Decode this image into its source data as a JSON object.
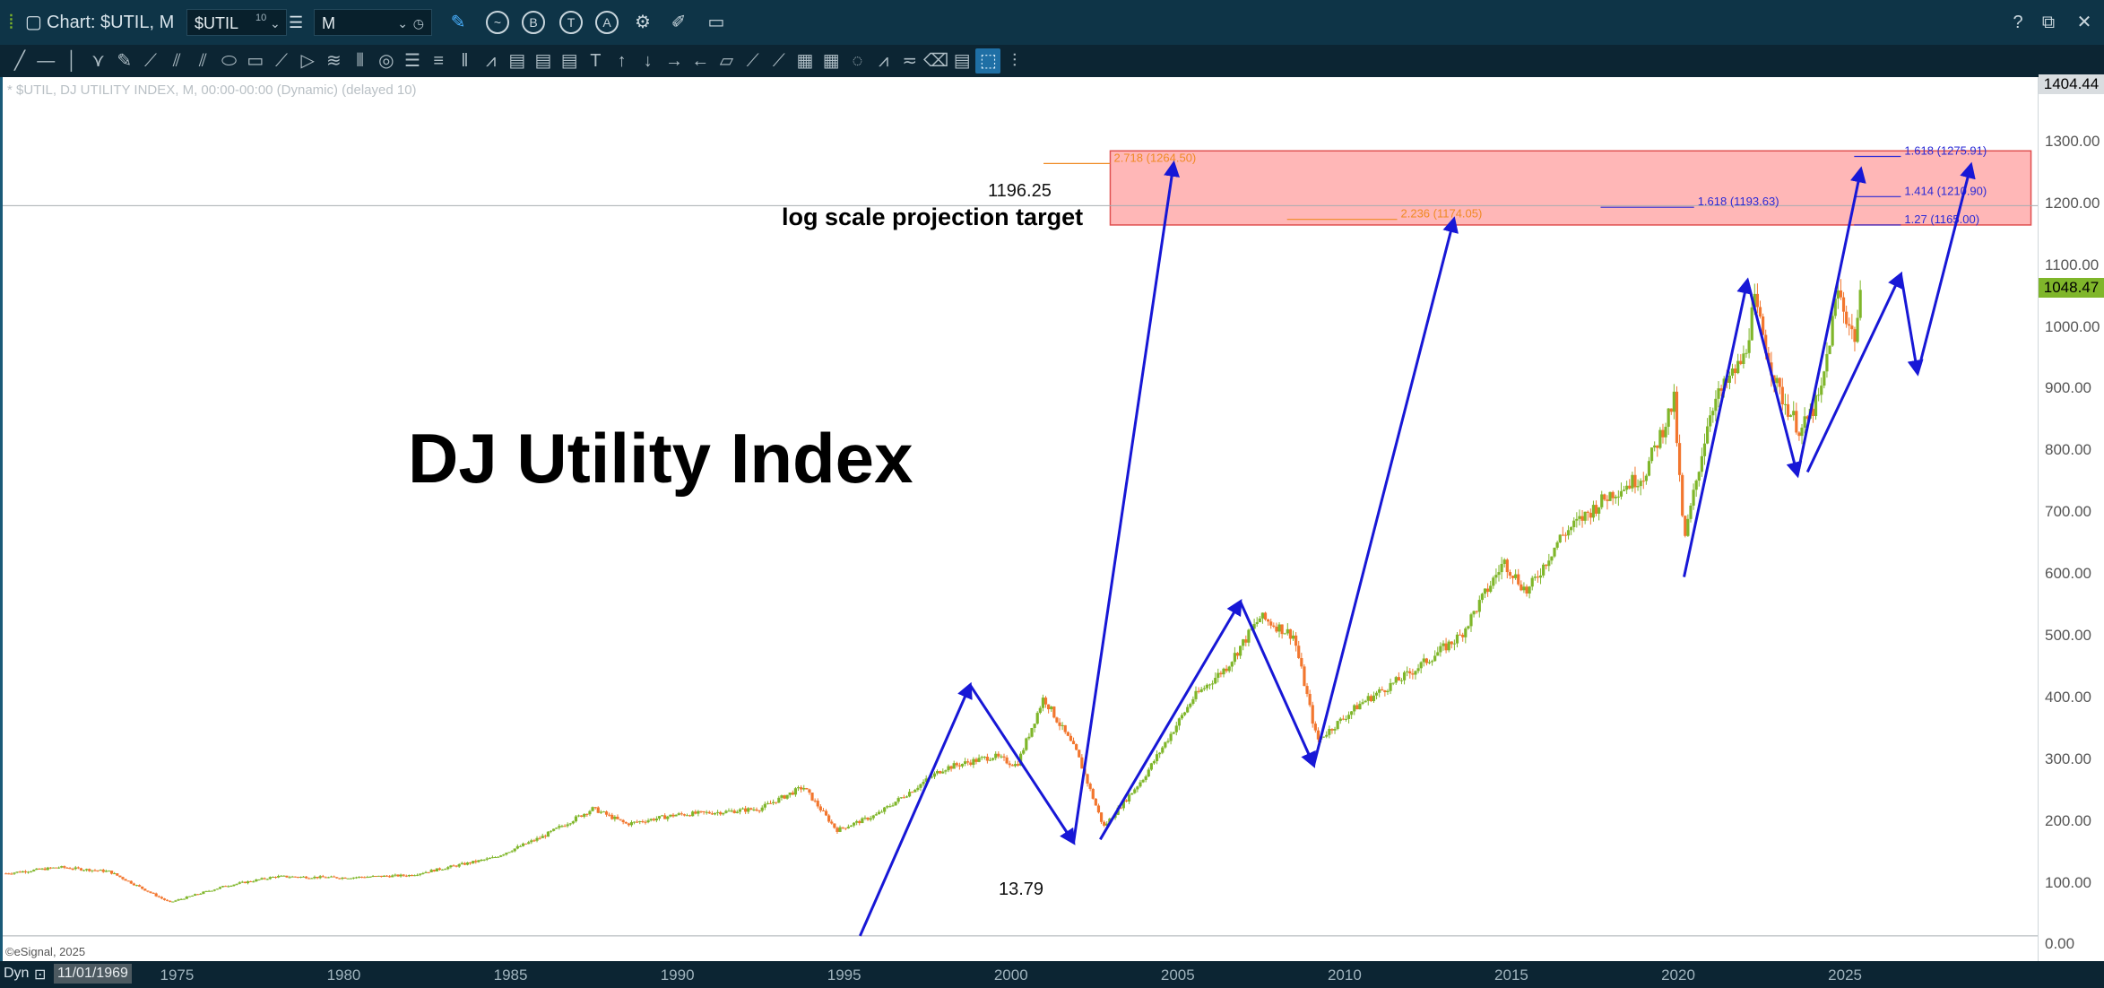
{
  "window": {
    "title": "Chart: $UTIL, M",
    "symbol": "$UTIL",
    "symbol_superscript": "10",
    "interval": "M",
    "right_icons": [
      "help-icon",
      "window-icon",
      "close-icon"
    ]
  },
  "chart_info_line": "* $UTIL, DJ UTILITY INDEX, M, 00:00-00:00 (Dynamic) (delayed 10)",
  "copyright": "©eSignal, 2025",
  "status": {
    "mode": "Dyn",
    "date": "11/01/1969"
  },
  "annotations": {
    "title": "DJ Utility Index",
    "projection_label": "log scale projection target",
    "upper_level_label": "1196.25",
    "lower_level_label": "13.79"
  },
  "price_badges": {
    "top": "1404.44",
    "last": "1048.47"
  },
  "fib_labels": {
    "orange": [
      "2.718 (1264.50)",
      "2.236 (1174.05)"
    ],
    "blue": [
      "1.618 (1193.63)",
      "1.618 (1275.91)",
      "1.414 (1210.90)",
      "1.27 (1165.00)"
    ]
  },
  "colors": {
    "up": "#7fb62a",
    "down": "#f2762e",
    "wave": "#1717d6",
    "zone": "#ffb3b3",
    "zone_border": "#e05050"
  },
  "chart_data": {
    "type": "candlestick",
    "title": "DJ Utility Index",
    "x_ticks": [
      "1975",
      "1980",
      "1985",
      "1990",
      "1995",
      "2000",
      "2005",
      "2010",
      "2015",
      "2020",
      "2025"
    ],
    "y_ticks": [
      "1300.00",
      "1200.00",
      "1100.00",
      "1000.00",
      "900.00",
      "800.00",
      "700.00",
      "600.00",
      "500.00",
      "400.00",
      "300.00",
      "200.00",
      "100.00",
      "0.00"
    ],
    "ylim": [
      -27,
      1404.44
    ],
    "xlim": [
      1969.8,
      2030.8
    ],
    "horizontal_levels": [
      1196.25,
      13.79
    ],
    "target_zone": {
      "x_from": 2003.0,
      "x_to": 2030.6,
      "y_from": 1165,
      "y_to": 1285
    },
    "price_path": [
      [
        1969.9,
        115
      ],
      [
        1971.5,
        125
      ],
      [
        1973.0,
        118
      ],
      [
        1974.8,
        68
      ],
      [
        1976.5,
        95
      ],
      [
        1978.0,
        110
      ],
      [
        1980.0,
        108
      ],
      [
        1982.0,
        112
      ],
      [
        1984.5,
        140
      ],
      [
        1986.0,
        175
      ],
      [
        1987.5,
        220
      ],
      [
        1988.5,
        195
      ],
      [
        1990.0,
        210
      ],
      [
        1991.5,
        215
      ],
      [
        1992.5,
        220
      ],
      [
        1993.8,
        255
      ],
      [
        1994.8,
        185
      ],
      [
        1996.0,
        210
      ],
      [
        1998.0,
        285
      ],
      [
        1999.5,
        305
      ],
      [
        2000.2,
        290
      ],
      [
        2001.0,
        400
      ],
      [
        2002.0,
        310
      ],
      [
        2002.8,
        190
      ],
      [
        2004.0,
        270
      ],
      [
        2005.5,
        400
      ],
      [
        2006.5,
        450
      ],
      [
        2007.5,
        530
      ],
      [
        2008.5,
        500
      ],
      [
        2009.2,
        330
      ],
      [
        2010.5,
        390
      ],
      [
        2012.0,
        440
      ],
      [
        2013.5,
        500
      ],
      [
        2014.8,
        620
      ],
      [
        2015.5,
        570
      ],
      [
        2016.5,
        660
      ],
      [
        2018.0,
        730
      ],
      [
        2019.0,
        760
      ],
      [
        2019.9,
        880
      ],
      [
        2020.2,
        650
      ],
      [
        2021.0,
        870
      ],
      [
        2022.0,
        950
      ],
      [
        2022.3,
        1040
      ],
      [
        2023.0,
        900
      ],
      [
        2023.7,
        830
      ],
      [
        2024.3,
        890
      ],
      [
        2024.8,
        1060
      ],
      [
        2025.3,
        980
      ],
      [
        2025.5,
        1048.47
      ]
    ],
    "wave_paths": [
      [
        [
          1995.5,
          13.79
        ],
        [
          1998.8,
          420
        ],
        [
          2001.9,
          165
        ],
        [
          2004.9,
          1264.5
        ]
      ],
      [
        [
          2002.7,
          170
        ],
        [
          2006.9,
          555
        ],
        [
          2009.1,
          290
        ],
        [
          2013.3,
          1174.05
        ]
      ],
      [
        [
          2020.2,
          595
        ],
        [
          2022.1,
          1075
        ],
        [
          2023.6,
          760
        ],
        [
          2025.5,
          1255
        ]
      ],
      [
        [
          2023.9,
          765
        ],
        [
          2026.7,
          1085
        ],
        [
          2027.2,
          925
        ],
        [
          2028.8,
          1262
        ]
      ]
    ],
    "fib_lines": [
      {
        "label": "2.718 (1264.50)",
        "value": 1264.5,
        "x_from": 2001.0,
        "x_to": 2003.0,
        "color": "orange"
      },
      {
        "label": "2.236 (1174.05)",
        "value": 1174.05,
        "x_from": 2008.3,
        "x_to": 2011.6,
        "color": "orange"
      },
      {
        "label": "1.618 (1193.63)",
        "value": 1193.63,
        "x_from": 2017.7,
        "x_to": 2020.5,
        "color": "blue"
      },
      {
        "label": "1.618 (1275.91)",
        "value": 1275.91,
        "x_from": 2025.3,
        "x_to": 2026.7,
        "color": "blue"
      },
      {
        "label": "1.414 (1210.90)",
        "value": 1210.9,
        "x_from": 2025.3,
        "x_to": 2026.7,
        "color": "blue"
      },
      {
        "label": "1.27 (1165.00)",
        "value": 1165.0,
        "x_from": 2025.3,
        "x_to": 2026.7,
        "color": "blue"
      }
    ]
  }
}
